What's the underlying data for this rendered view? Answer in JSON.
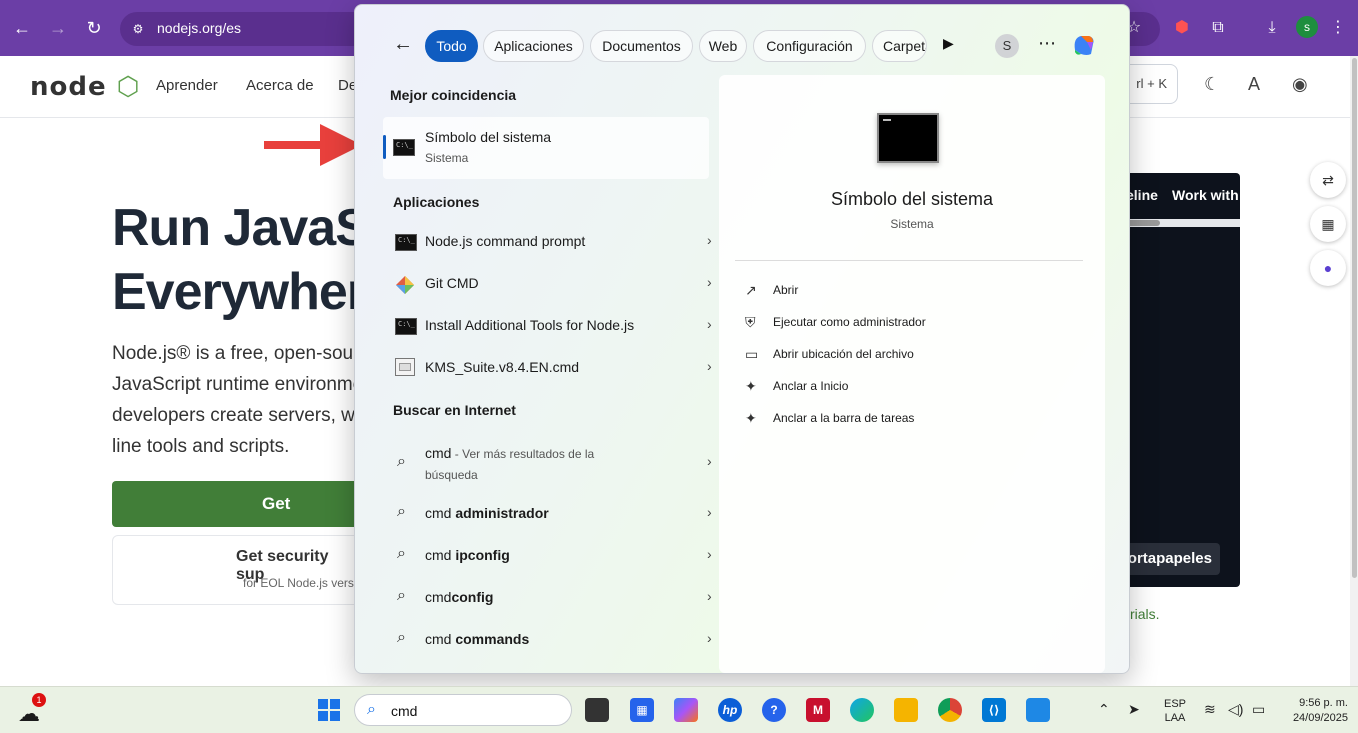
{
  "browser": {
    "url": "nodejs.org/es",
    "profile_initial": "s"
  },
  "node_page": {
    "logo_text": "node",
    "nav": [
      "Aprender",
      "Acerca de",
      "De"
    ],
    "kbd_hint": "rl + K",
    "hero_title": "Run JavaScr\nEverywhere",
    "hero_desc": "Node.js® is a free, open-sour JavaScript runtime environme developers create servers, we line tools and scripts.",
    "get_node_label": "Get Node.js®",
    "security_title": "Get security sup",
    "security_sub": "for EOL Node.js vers",
    "code_tab_a": "eline",
    "code_tab_b": "Work with",
    "code_snippet": ";",
    "copy_label": "ortapapeles",
    "tutorials_link": "rials.",
    "side_widgets": [
      "translate-icon",
      "apps-icon",
      "assistant-icon"
    ]
  },
  "search": {
    "tabs": [
      "Todo",
      "Aplicaciones",
      "Documentos",
      "Web",
      "Configuración",
      "Carpeta"
    ],
    "active_tab": "Todo",
    "user_initial": "S",
    "best_match_heading": "Mejor coincidencia",
    "best_match": {
      "title": "Símbolo del sistema",
      "subtitle": "Sistema"
    },
    "apps_heading": "Aplicaciones",
    "apps": [
      {
        "label": "Node.js command prompt",
        "icon": "cmd-icon"
      },
      {
        "label": "Git CMD",
        "icon": "git-icon"
      },
      {
        "label": "Install Additional Tools for Node.js",
        "icon": "cmd-icon"
      },
      {
        "label": "KMS_Suite.v8.4.EN.cmd",
        "icon": "script-icon"
      }
    ],
    "web_heading": "Buscar en Internet",
    "web": [
      {
        "prefix": "cmd",
        "bold": "",
        "extra": " - Ver más resultados de la",
        "extra2": "búsqueda"
      },
      {
        "prefix": "cmd ",
        "bold": "administrador"
      },
      {
        "prefix": "cmd ",
        "bold": "ipconfig"
      },
      {
        "prefix": "cmd",
        "bold": "config"
      },
      {
        "prefix": "cmd ",
        "bold": "commands"
      }
    ],
    "detail": {
      "title": "Símbolo del sistema",
      "subtitle": "Sistema",
      "actions": [
        {
          "label": "Abrir",
          "icon": "open-icon"
        },
        {
          "label": "Ejecutar como administrador",
          "icon": "shield-icon"
        },
        {
          "label": "Abrir ubicación del archivo",
          "icon": "folder-icon"
        },
        {
          "label": "Anclar a Inicio",
          "icon": "pin-icon"
        },
        {
          "label": "Anclar a la barra de tareas",
          "icon": "pin-icon"
        }
      ]
    }
  },
  "taskbar": {
    "weather_badge": "1",
    "search_value": "cmd",
    "lang_line1": "ESP",
    "lang_line2": "LAA",
    "time": "9:56 p. m.",
    "date": "24/09/2025"
  },
  "colors": {
    "browser_bar": "#6b3ea6",
    "node_green": "#417e38",
    "accent_blue": "#0f5cc0",
    "annotation_red": "#e8403c"
  }
}
